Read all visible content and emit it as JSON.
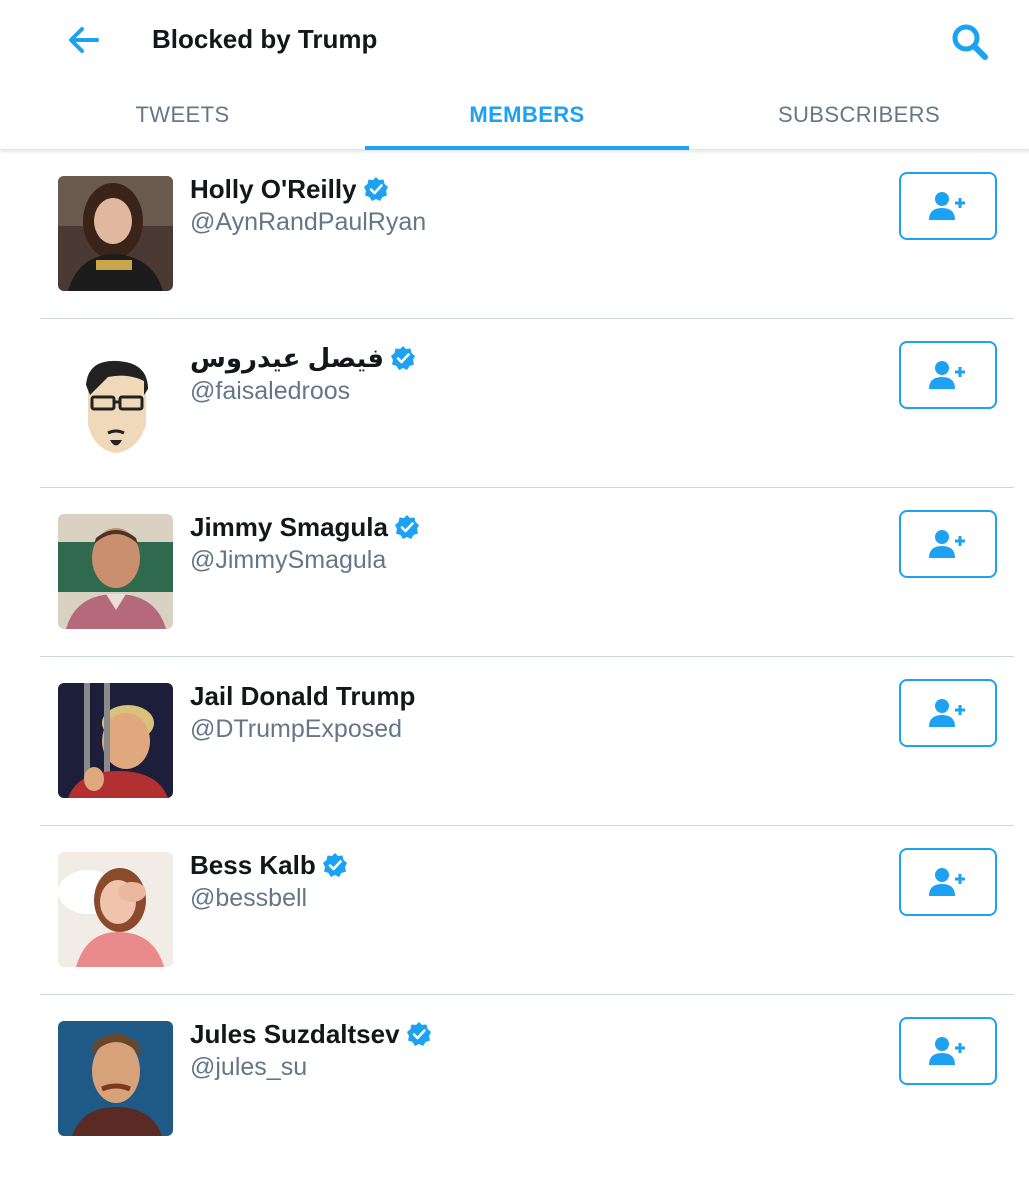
{
  "header": {
    "title": "Blocked by Trump",
    "back_icon": "arrow-left-icon",
    "search_icon": "search-icon"
  },
  "tabs": [
    {
      "label": "TWEETS",
      "active": false
    },
    {
      "label": "MEMBERS",
      "active": true
    },
    {
      "label": "SUBSCRIBERS",
      "active": false
    }
  ],
  "members": [
    {
      "name": "Holly O'Reilly",
      "handle": "@AynRandPaulRyan",
      "verified": true
    },
    {
      "name": "فيصل عيدروس",
      "handle": "@faisaledroos",
      "verified": true
    },
    {
      "name": "Jimmy Smagula",
      "handle": "@JimmySmagula",
      "verified": true
    },
    {
      "name": "Jail Donald Trump",
      "handle": "@DTrumpExposed",
      "verified": false
    },
    {
      "name": "Bess Kalb",
      "handle": "@bessbell",
      "verified": true
    },
    {
      "name": "Jules Suzdaltsev",
      "handle": "@jules_su",
      "verified": true
    }
  ],
  "colors": {
    "accent": "#1da1f2",
    "text_primary": "#14171a",
    "text_secondary": "#657786",
    "divider": "#ccd6dd"
  }
}
